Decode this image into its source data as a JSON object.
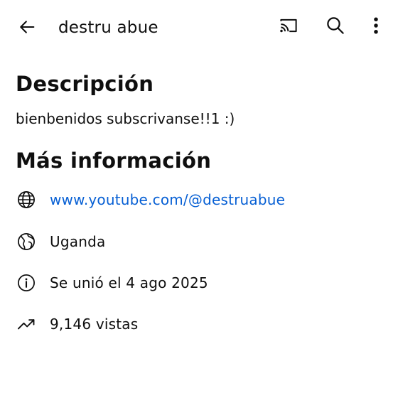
{
  "header": {
    "channel_name": "destru abue",
    "back_icon": "arrow-left-icon",
    "cast_icon": "cast-icon",
    "search_icon": "search-icon",
    "more_icon": "more-vert-icon"
  },
  "description": {
    "title": "Descripción",
    "text": "bienbenidos subscrivanse!!1 :)"
  },
  "more_info": {
    "title": "Más información",
    "link": "www.youtube.com/@destruabue",
    "country": "Uganda",
    "joined": "Se unió el 4 ago 2025",
    "views": "9,146 vistas"
  },
  "colors": {
    "link": "#065fd4",
    "text": "#0f0f0f",
    "background": "#ffffff"
  }
}
